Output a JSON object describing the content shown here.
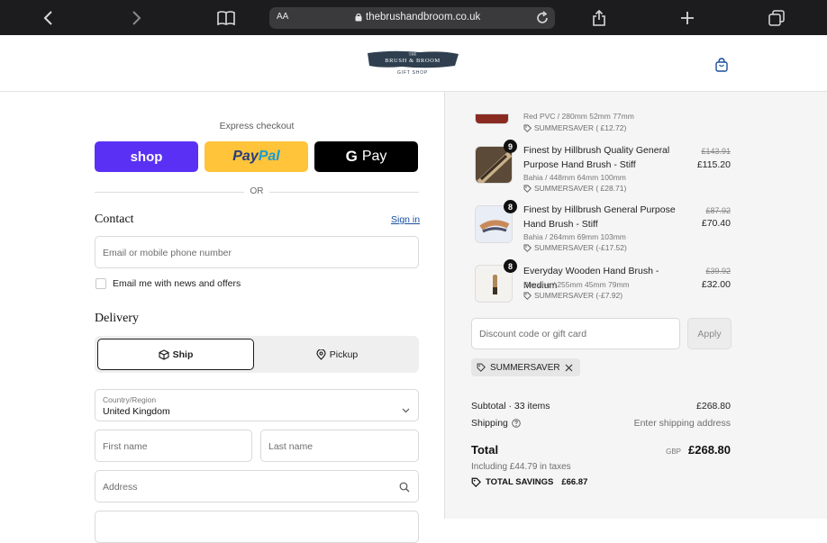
{
  "browser": {
    "text_size_label": "AA",
    "url": "thebrushandbroom.co.uk"
  },
  "header": {
    "logo_line1": "THE",
    "logo_line2": "BRUSH & BROOM",
    "logo_line3": "GIFT SHOP"
  },
  "express": {
    "title": "Express checkout",
    "shop_label": "shop",
    "paypal_label_a": "Pay",
    "paypal_label_b": "Pal",
    "gpay_label_g": "G",
    "gpay_label": "Pay",
    "or_label": "OR"
  },
  "contact": {
    "heading": "Contact",
    "signin_label": "Sign in",
    "email_placeholder": "Email or mobile phone number",
    "newsletter_label": "Email me with news and offers"
  },
  "delivery": {
    "heading": "Delivery",
    "ship_label": "Ship",
    "pickup_label": "Pickup",
    "country_label": "Country/Region",
    "country_value": "United Kingdom",
    "first_name_placeholder": "First name",
    "last_name_placeholder": "Last name",
    "address_placeholder": "Address"
  },
  "order": {
    "items": [
      {
        "variant": "Red PVC / 280mm 52mm 77mm",
        "discount": "SUMMERSAVER ( £12.72)"
      },
      {
        "qty": "9",
        "name": "Finest by Hillbrush Quality General Purpose Hand Brush - Stiff",
        "variant": "Bahia / 448mm 64mm 100mm",
        "discount": "SUMMERSAVER ( £28.71)",
        "old_price": "£143.91",
        "price": "£115.20"
      },
      {
        "qty": "8",
        "name": "Finest by Hillbrush General Purpose Hand Brush - Stiff",
        "variant": "Bahia / 264mm 69mm 103mm",
        "discount": "SUMMERSAVER (-£17.52)",
        "old_price": "£87.92",
        "price": "£70.40"
      },
      {
        "qty": "8",
        "name": "Everyday Wooden Hand Brush - Medium",
        "variant": "Bassine / 255mm 45mm 79mm",
        "discount": "SUMMERSAVER (-£7.92)",
        "old_price": "£39.92",
        "price": "£32.00"
      }
    ],
    "discount_placeholder": "Discount code or gift card",
    "apply_label": "Apply",
    "applied_code": "SUMMERSAVER",
    "subtotal_label": "Subtotal · 33 items",
    "subtotal_value": "£268.80",
    "shipping_label": "Shipping",
    "shipping_value": "Enter shipping address",
    "total_label": "Total",
    "total_currency": "GBP",
    "total_value": "£268.80",
    "tax_note": "Including £44.79 in taxes",
    "savings_label": "TOTAL SAVINGS",
    "savings_value": "£66.87"
  },
  "colors": {
    "shop_purple": "#5a31f4",
    "paypal_yellow": "#ffc439",
    "link_blue": "#1a4fa0",
    "summary_bg": "#f5f5f5"
  }
}
